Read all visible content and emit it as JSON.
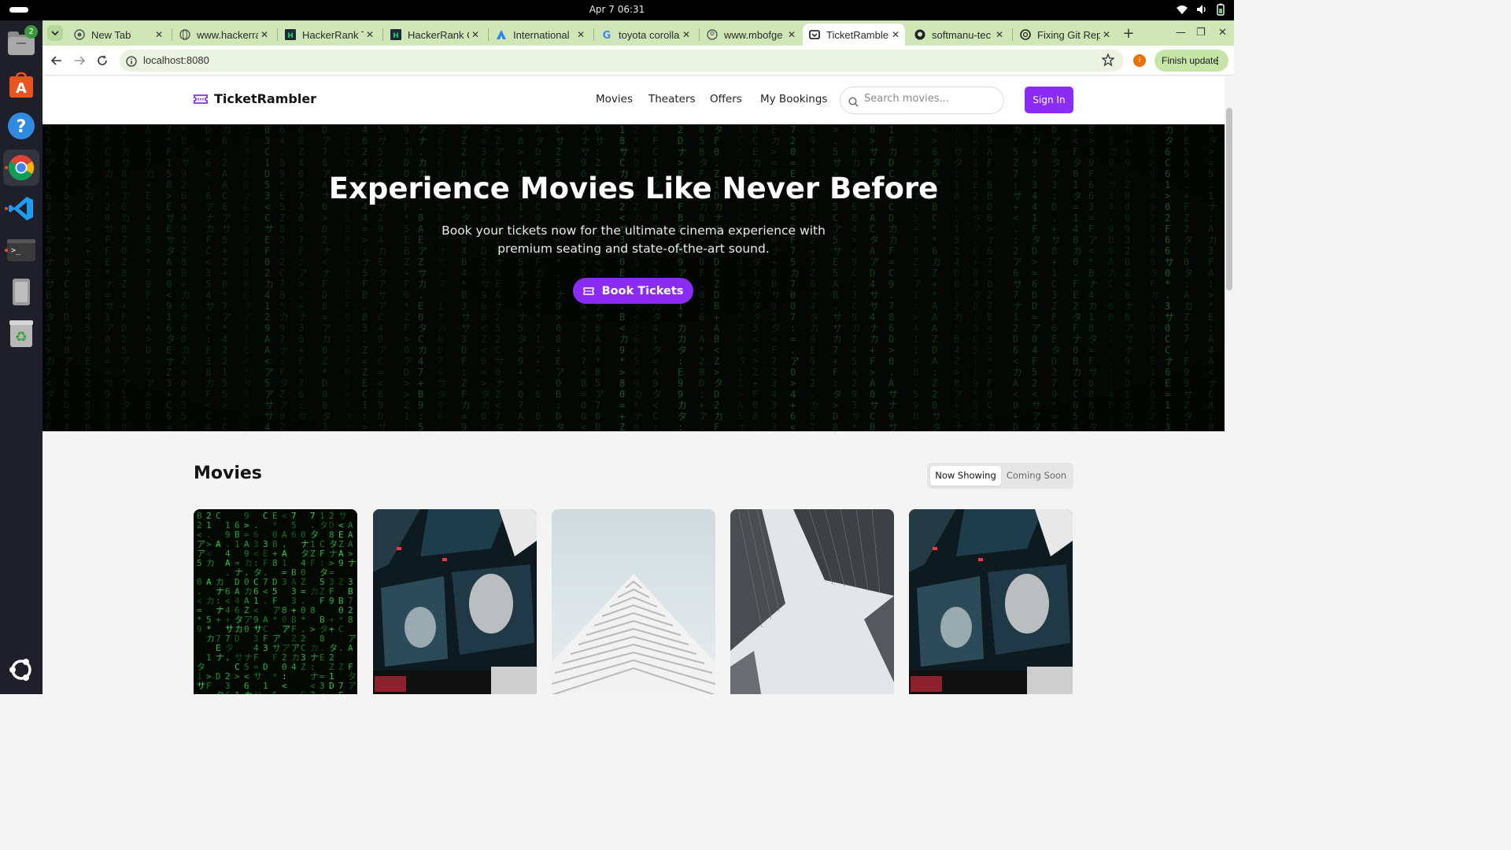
{
  "system": {
    "clock": "Apr 7  06:31",
    "dock_badge": "2",
    "dock_apps": [
      "files",
      "app-center",
      "help",
      "chrome",
      "vscode",
      "terminal",
      "device",
      "trash"
    ]
  },
  "browser": {
    "tabs": [
      {
        "title": "New Tab",
        "icon": "chrome"
      },
      {
        "title": "www.hackerrank",
        "icon": "globe"
      },
      {
        "title": "HackerRank Tr",
        "icon": "hackerrank"
      },
      {
        "title": "HackerRank Ce",
        "icon": "hackerrank"
      },
      {
        "title": "International",
        "icon": "atlassian"
      },
      {
        "title": "toyota corolla",
        "icon": "google"
      },
      {
        "title": "www.mbofge",
        "icon": "globe"
      },
      {
        "title": "TicketRambler",
        "icon": "ticket"
      },
      {
        "title": "softmanu-tec",
        "icon": "github"
      },
      {
        "title": "Fixing Git Rep",
        "icon": "openai"
      }
    ],
    "url": "localhost:8080",
    "profile_initial": "i",
    "finish_update": "Finish update"
  },
  "site": {
    "brand": "TicketRambler",
    "nav": [
      "Movies",
      "Theaters",
      "Offers",
      "My Bookings"
    ],
    "search_placeholder": "Search movies...",
    "signin": "Sign In",
    "accent": "#8b2cf5"
  },
  "hero": {
    "title": "Experience Movies Like Never Before",
    "subtitle": "Book your tickets now for the ultimate cinema experience with premium seating and state-of-the-art sound.",
    "cta": "Book Tickets"
  },
  "movies": {
    "title": "Movies",
    "toggle": [
      "Now Showing",
      "Coming Soon"
    ],
    "cards": [
      "matrix-code",
      "screens",
      "tower",
      "skyscrapers",
      "screens"
    ]
  }
}
